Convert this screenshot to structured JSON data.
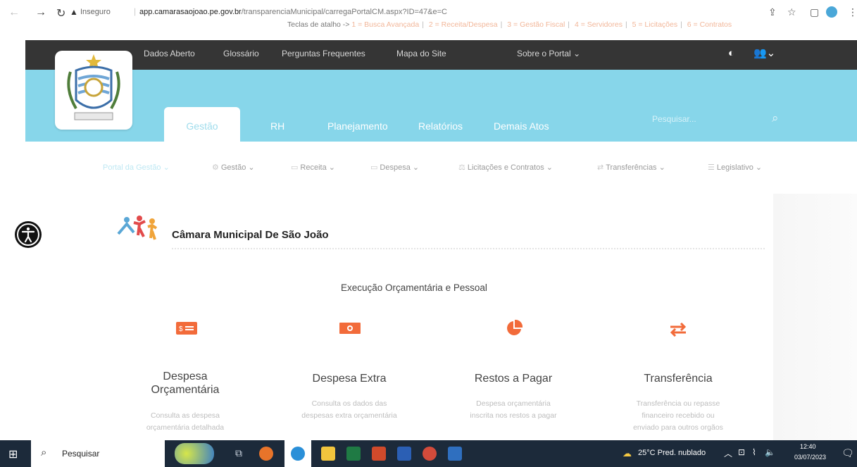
{
  "browser": {
    "security_label": "Inseguro",
    "url_host": "app.camarasaojoao.pe.gov.br",
    "url_path": "/transparenciaMunicipal/carregaPortalCM.aspx?ID=47&e=C",
    "icons": [
      "back-icon",
      "forward-icon",
      "reload-icon",
      "warning-icon",
      "share-icon",
      "star-icon",
      "sidebar-icon",
      "extension-icon",
      "menu-icon"
    ]
  },
  "shortcuts": {
    "prefix": "Teclas de atalho ->",
    "items": [
      "1 = Busca Avançada",
      "2 = Receita/Despesa",
      "3 = Gestão Fiscal",
      "4 = Servidores",
      "5 = Licitações",
      "6 = Contratos"
    ]
  },
  "topbar": {
    "links": [
      "Dados Aberto",
      "Glossário",
      "Perguntas Frequentes",
      "Mapa do Site"
    ],
    "about": "Sobre o Portal"
  },
  "tabs": [
    "Gestão",
    "RH",
    "Planejamento",
    "Relatórios",
    "Demais Atos"
  ],
  "search": {
    "placeholder": "Pesquisar..."
  },
  "menu": [
    "Portal da Gestão",
    "Gestão",
    "Receita",
    "Despesa",
    "Licitações e Contratos",
    "Transferências",
    "Legislativo"
  ],
  "entity": {
    "title": "Câmara Municipal De São João"
  },
  "section": {
    "title": "Execução Orçamentária e Pessoal",
    "features": [
      {
        "title_line1": "Despesa",
        "title_line2": "Orçamentária",
        "desc_line1": "Consulta as despesa",
        "desc_line2": "orçamentária detalhada",
        "icon": "money-icon"
      },
      {
        "title_line1": "Despesa Extra",
        "title_line2": "",
        "desc_line1": "Consulta os dados das",
        "desc_line2": "despesas extra orçamentária",
        "icon": "banknote-icon"
      },
      {
        "title_line1": "Restos a Pagar",
        "title_line2": "",
        "desc_line1": "Despesa orçamentária",
        "desc_line2": "inscrita nos restos a pagar",
        "icon": "pie-chart-icon"
      },
      {
        "title_line1": "Transferência",
        "title_line2": "",
        "desc_line1": "Transferência ou repasse",
        "desc_line2": "financeiro recebido ou",
        "desc_line3": "enviado para outros orgãos",
        "icon": "exchange-icon"
      }
    ]
  },
  "taskbar": {
    "search_placeholder": "Pesquisar",
    "weather": "25°C Pred. nublado",
    "time": "12:40",
    "date": "03/07/2023"
  },
  "colors": {
    "accent": "#f26b3a",
    "cyan": "#87d6ea",
    "dark": "#353535"
  }
}
